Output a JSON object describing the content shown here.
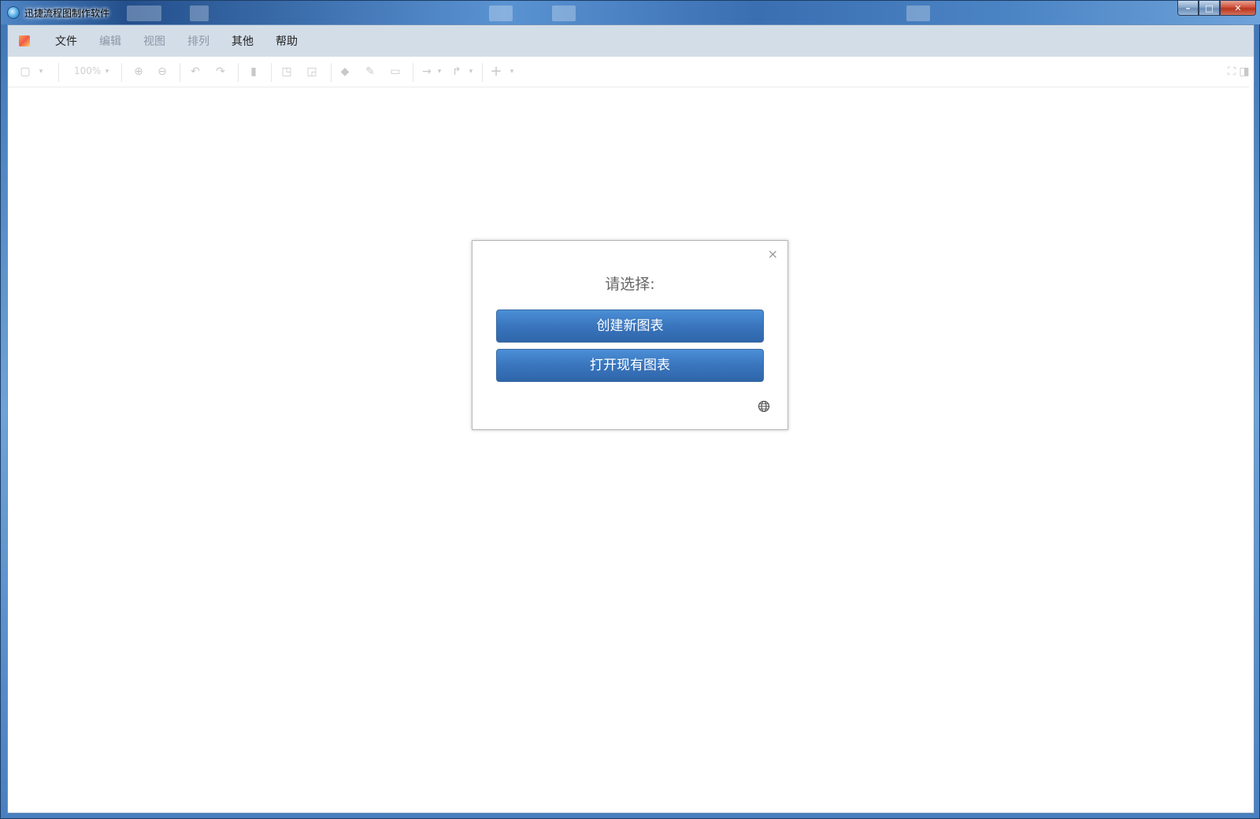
{
  "window": {
    "title": "迅捷流程图制作软件",
    "controls": {
      "minimize": "–",
      "maximize": "□",
      "close": "✕"
    }
  },
  "menubar": {
    "items": [
      {
        "label": "文件",
        "enabled": true
      },
      {
        "label": "编辑",
        "enabled": false
      },
      {
        "label": "视图",
        "enabled": false
      },
      {
        "label": "排列",
        "enabled": false
      },
      {
        "label": "其他",
        "enabled": true
      },
      {
        "label": "帮助",
        "enabled": true
      }
    ]
  },
  "toolbar": {
    "zoom": "100%"
  },
  "dialog": {
    "close_label": "×",
    "title": "请选择:",
    "create_label": "创建新图表",
    "open_label": "打开现有图表"
  },
  "colors": {
    "button_primary": "#3975bd",
    "menubar_bg": "#d3dde8",
    "disabled_text": "#8a97a6"
  }
}
